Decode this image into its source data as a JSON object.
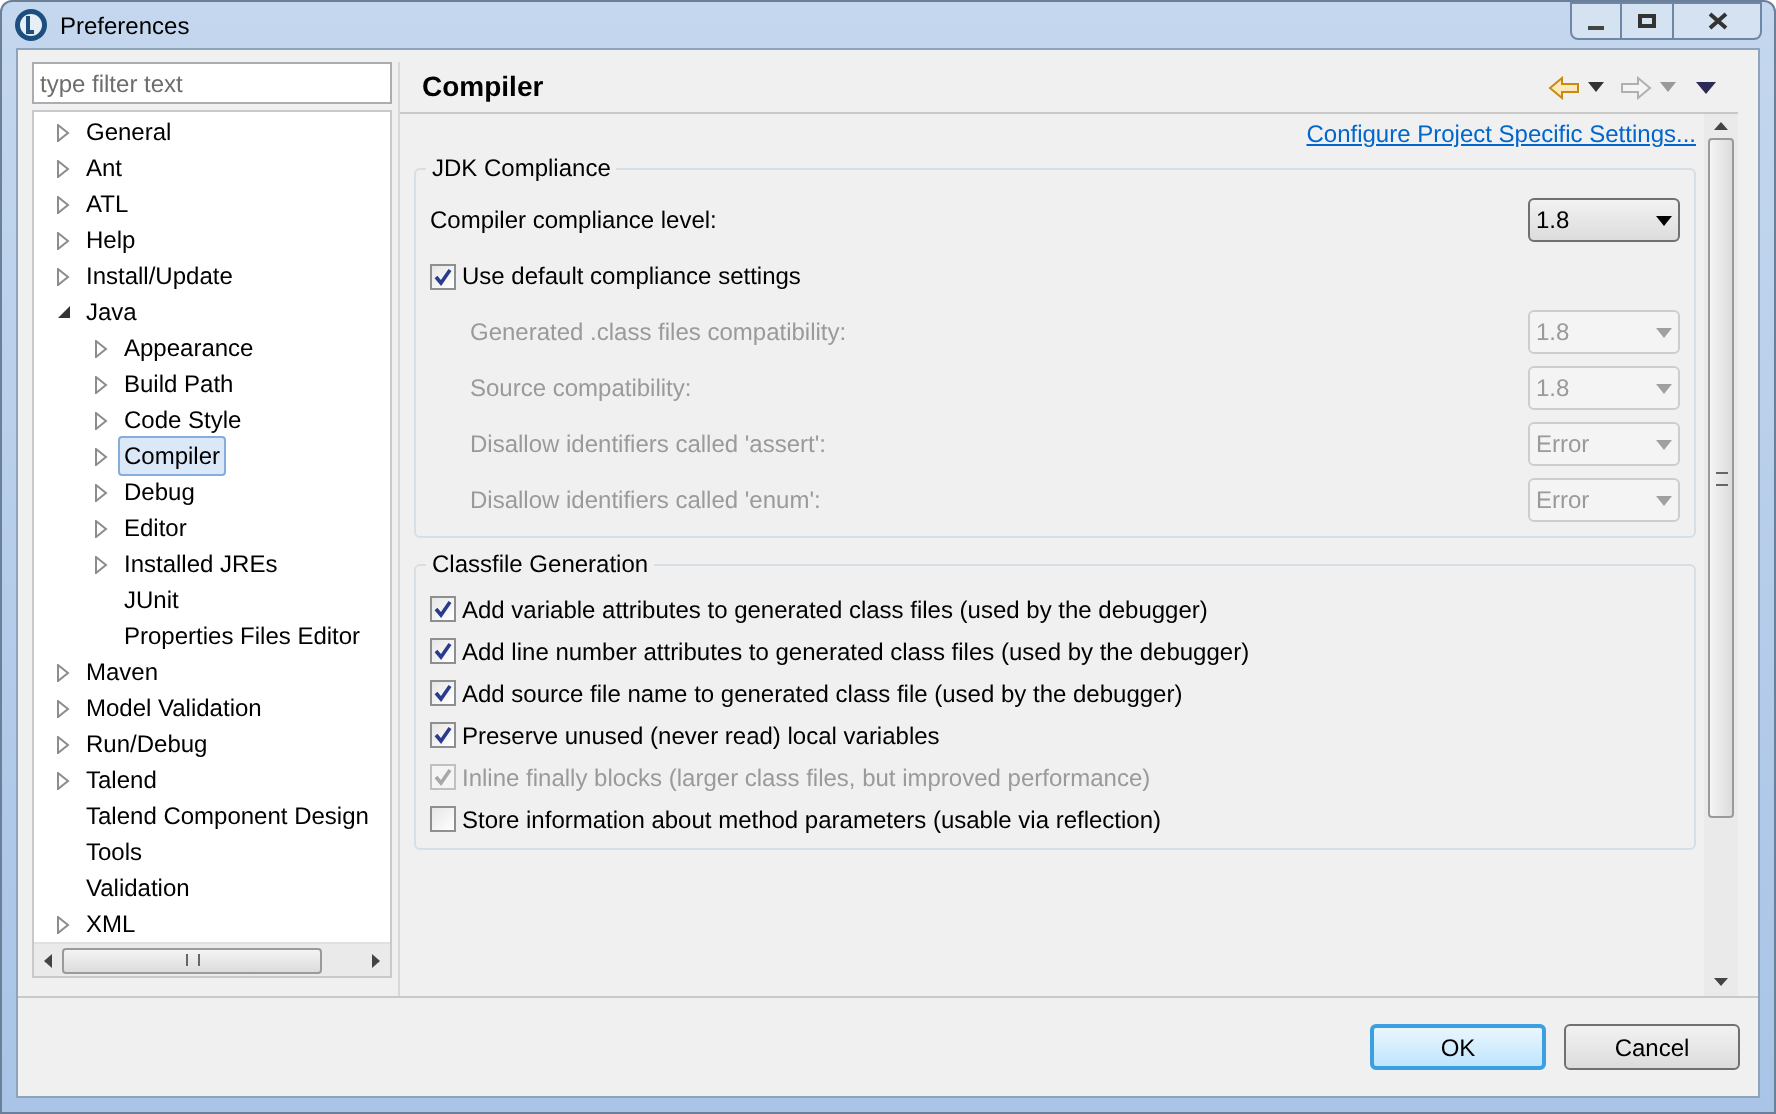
{
  "window": {
    "title": "Preferences"
  },
  "filter": {
    "placeholder": "type filter text"
  },
  "tree": [
    {
      "label": "General",
      "expanded": false,
      "selected": false
    },
    {
      "label": "Ant",
      "expanded": false,
      "selected": false
    },
    {
      "label": "ATL",
      "expanded": false,
      "selected": false
    },
    {
      "label": "Help",
      "expanded": false,
      "selected": false
    },
    {
      "label": "Install/Update",
      "expanded": false,
      "selected": false
    },
    {
      "label": "Java",
      "expanded": true,
      "selected": false,
      "children": [
        {
          "label": "Appearance",
          "expanded": false,
          "selected": false
        },
        {
          "label": "Build Path",
          "expanded": false,
          "selected": false
        },
        {
          "label": "Code Style",
          "expanded": false,
          "selected": false
        },
        {
          "label": "Compiler",
          "expanded": false,
          "selected": true
        },
        {
          "label": "Debug",
          "expanded": false,
          "selected": false
        },
        {
          "label": "Editor",
          "expanded": false,
          "selected": false
        },
        {
          "label": "Installed JREs",
          "expanded": false,
          "selected": false
        },
        {
          "label": "JUnit",
          "selected": false
        },
        {
          "label": "Properties Files Editor",
          "selected": false
        }
      ]
    },
    {
      "label": "Maven",
      "expanded": false,
      "selected": false
    },
    {
      "label": "Model Validation",
      "expanded": false,
      "selected": false
    },
    {
      "label": "Run/Debug",
      "expanded": false,
      "selected": false
    },
    {
      "label": "Talend",
      "expanded": false,
      "selected": false
    },
    {
      "label": "Talend Component Design",
      "selected": false
    },
    {
      "label": "Tools",
      "selected": false
    },
    {
      "label": "Validation",
      "selected": false
    },
    {
      "label": "XML",
      "expanded": false,
      "selected": false
    }
  ],
  "page": {
    "title": "Compiler",
    "link": "Configure Project Specific Settings...",
    "groups": [
      {
        "title": "JDK Compliance",
        "rows": [
          {
            "kind": "select",
            "label": "Compiler compliance level:",
            "value": "1.8",
            "disabled": false,
            "indent": false
          },
          {
            "kind": "checkbox",
            "label": "Use default compliance settings",
            "checked": true,
            "disabled": false
          },
          {
            "kind": "select",
            "label": "Generated .class files compatibility:",
            "value": "1.8",
            "disabled": true,
            "indent": true
          },
          {
            "kind": "select",
            "label": "Source compatibility:",
            "value": "1.8",
            "disabled": true,
            "indent": true
          },
          {
            "kind": "select",
            "label": "Disallow identifiers called 'assert':",
            "value": "Error",
            "disabled": true,
            "indent": true
          },
          {
            "kind": "select",
            "label": "Disallow identifiers called 'enum':",
            "value": "Error",
            "disabled": true,
            "indent": true
          }
        ]
      },
      {
        "title": "Classfile Generation",
        "rows": [
          {
            "kind": "checkbox",
            "label": "Add variable attributes to generated class files (used by the debugger)",
            "checked": true,
            "disabled": false
          },
          {
            "kind": "checkbox",
            "label": "Add line number attributes to generated class files (used by the debugger)",
            "checked": true,
            "disabled": false
          },
          {
            "kind": "checkbox",
            "label": "Add source file name to generated class file (used by the debugger)",
            "checked": true,
            "disabled": false
          },
          {
            "kind": "checkbox",
            "label": "Preserve unused (never read) local variables",
            "checked": true,
            "disabled": false
          },
          {
            "kind": "checkbox",
            "label": "Inline finally blocks (larger class files, but improved performance)",
            "checked": true,
            "disabled": true
          },
          {
            "kind": "checkbox",
            "label": "Store information about method parameters (usable via reflection)",
            "checked": false,
            "disabled": false
          }
        ]
      }
    ]
  },
  "buttons": [
    {
      "label": "OK",
      "default": true
    },
    {
      "label": "Cancel",
      "default": false
    }
  ]
}
